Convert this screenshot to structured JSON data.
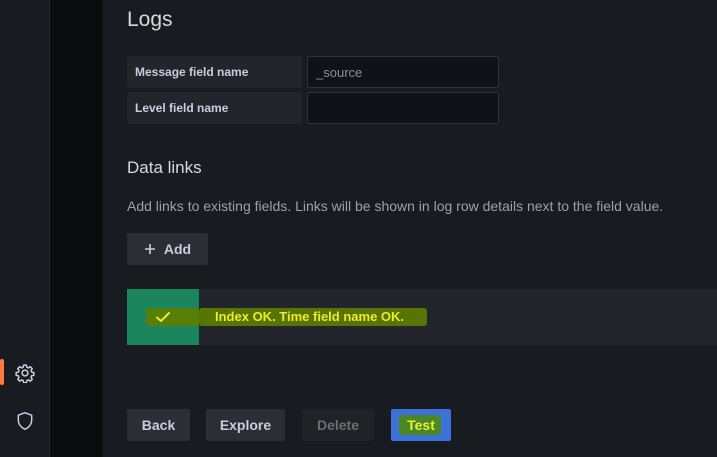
{
  "sidebar": {
    "items": [
      {
        "icon": "gear-icon",
        "active": true
      },
      {
        "icon": "shield-icon",
        "active": false
      }
    ]
  },
  "logs": {
    "title": "Logs",
    "fields": [
      {
        "label": "Message field name",
        "value": "",
        "placeholder": "_source"
      },
      {
        "label": "Level field name",
        "value": "",
        "placeholder": ""
      }
    ]
  },
  "data_links": {
    "title": "Data links",
    "description": "Add links to existing fields. Links will be shown in log row details next to the field value.",
    "add_label": "Add"
  },
  "alert": {
    "status": "success",
    "message": "Index OK. Time field name OK."
  },
  "actions": {
    "back_label": "Back",
    "explore_label": "Explore",
    "delete_label": "Delete",
    "test_label": "Test"
  },
  "colors": {
    "active_indicator": "#ff7941",
    "success": "#1b855e",
    "primary": "#3d71d9",
    "highlight_text": "#ecec2c"
  }
}
